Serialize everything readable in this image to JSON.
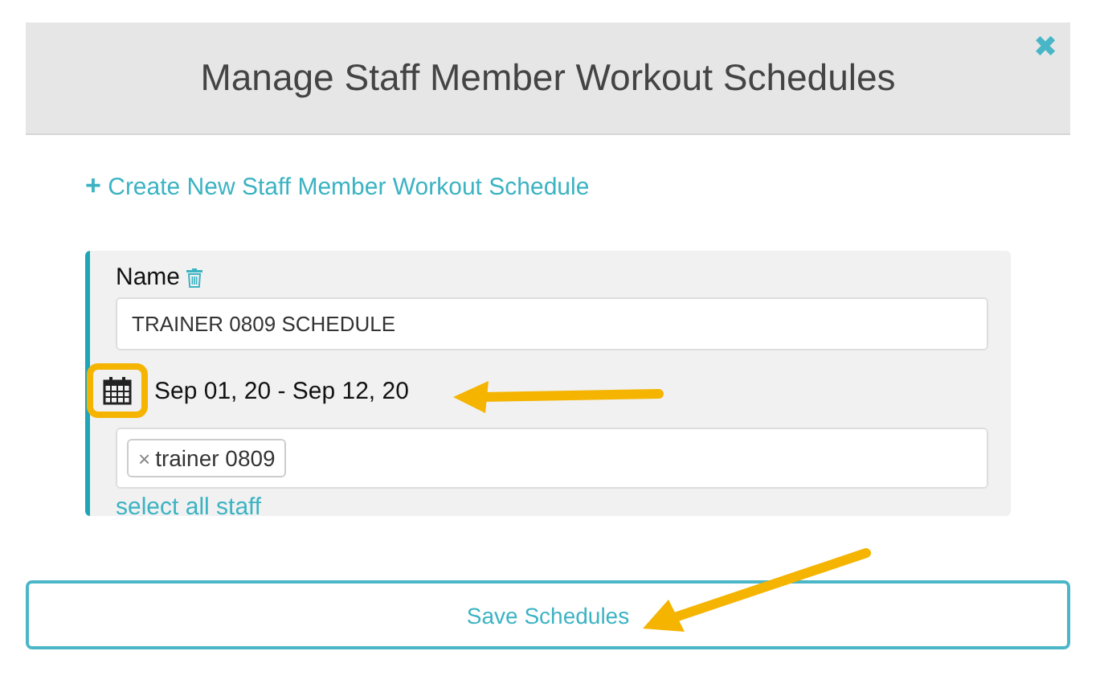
{
  "dialog": {
    "title": "Manage Staff Member Workout Schedules",
    "close_icon": "✖"
  },
  "create_link": {
    "icon": "+",
    "label": "Create New Staff Member Workout Schedule"
  },
  "schedules": [
    {
      "name_label": "Name",
      "name_value": "TRAINER 0809 SCHEDULE",
      "date_range": "Sep 01, 20 - Sep 12, 20",
      "staff_tags": [
        {
          "remove": "×",
          "label": "trainer 0809"
        }
      ],
      "select_all": "select all staff"
    }
  ],
  "save_button": "Save Schedules"
}
